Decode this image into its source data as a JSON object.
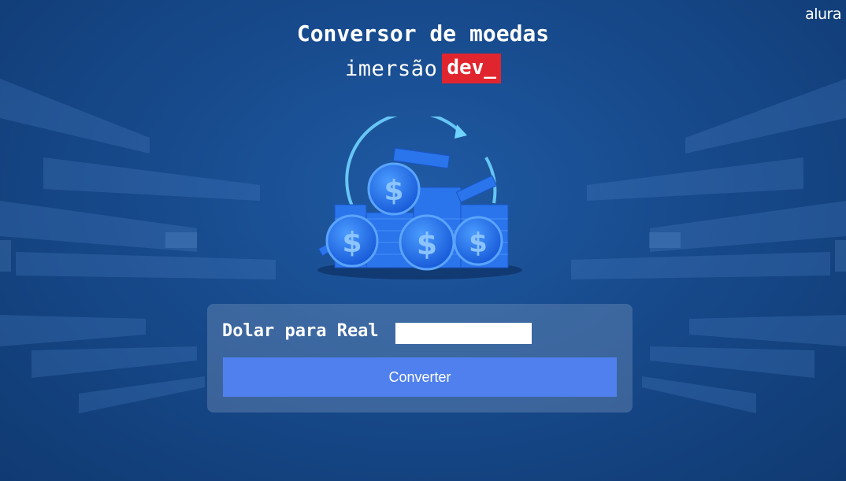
{
  "brand": "alura",
  "header": {
    "title": "Conversor de moedas",
    "subtitle_prefix": "imersão",
    "subtitle_badge": "dev_"
  },
  "converter": {
    "label": "Dolar para Real",
    "input_value": "",
    "button_label": "Converter"
  },
  "colors": {
    "background": "#174a8c",
    "badge": "#e0252e",
    "button": "#4f80ed"
  },
  "icons": [
    "coins-stack-icon",
    "dollar-icon"
  ]
}
